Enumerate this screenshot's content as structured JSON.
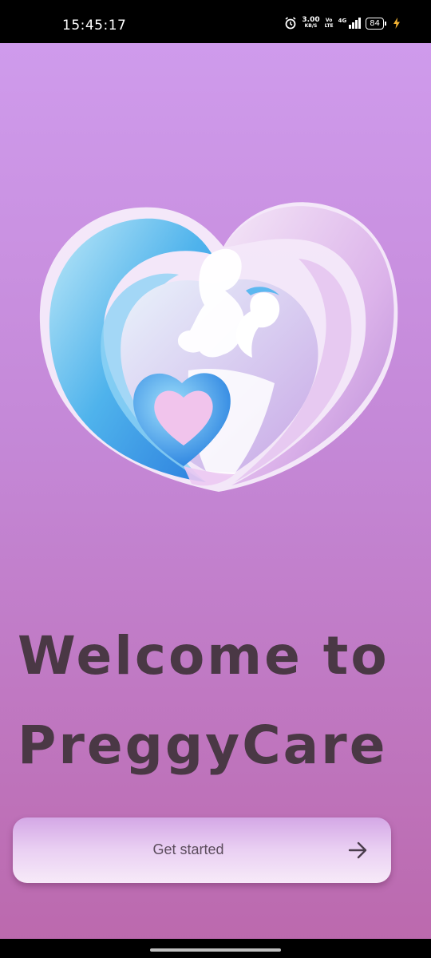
{
  "status_bar": {
    "time": "15:45:17",
    "net_speed_value": "3.00",
    "net_speed_unit": "KB/S",
    "volte_top": "Vo",
    "volte_bottom": "LTE",
    "network_type": "4G",
    "battery_level": "84",
    "icons": [
      "alarm-icon",
      "signal-icon",
      "battery-icon",
      "charging-bolt-icon"
    ]
  },
  "logo": {
    "icon": "mother-and-baby-heart-logo"
  },
  "welcome": {
    "line1": "Welcome to",
    "line2": "PreggyCare"
  },
  "get_started": {
    "label": "Get started",
    "icon": "arrow-right-icon"
  },
  "colors": {
    "background_top": "#cf9bec",
    "background_bottom": "#bb68ac",
    "title": "#4a3845",
    "button_text": "#5c4d5d"
  }
}
